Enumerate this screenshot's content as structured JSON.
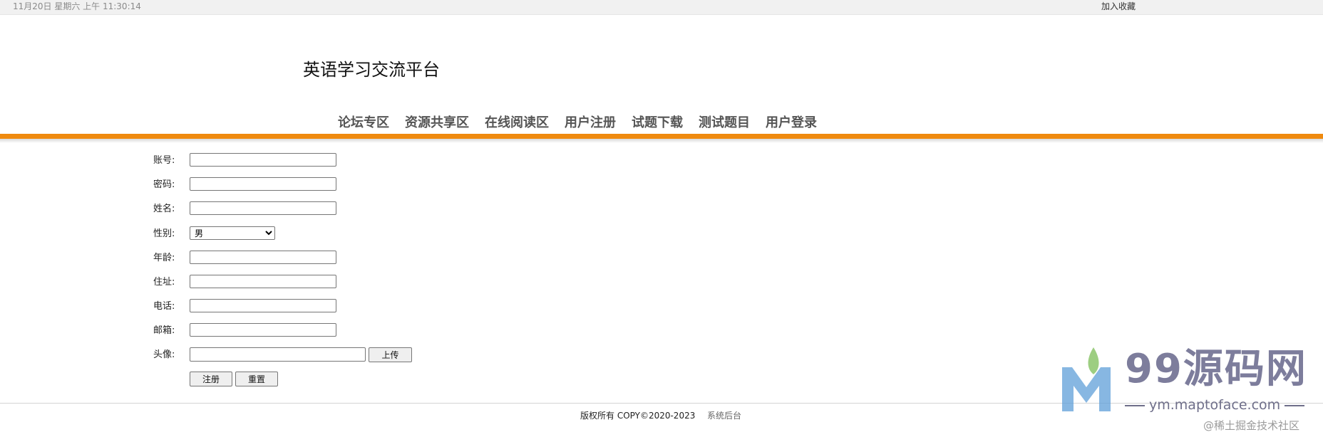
{
  "topbar": {
    "datetime": "11月20日 星期六 上午 11:30:14",
    "favorite_link": "加入收藏"
  },
  "header": {
    "title": "英语学习交流平台"
  },
  "nav": {
    "items": [
      "论坛专区",
      "资源共享区",
      "在线阅读区",
      "用户注册",
      "试题下载",
      "测试题目",
      "用户登录"
    ]
  },
  "form": {
    "account_label": "账号:",
    "account_value": "",
    "password_label": "密码:",
    "password_value": "",
    "name_label": "姓名:",
    "name_value": "",
    "gender_label": "性别:",
    "gender_selected": "男",
    "age_label": "年龄:",
    "age_value": "",
    "address_label": "住址:",
    "address_value": "",
    "phone_label": "电话:",
    "phone_value": "",
    "email_label": "邮箱:",
    "email_value": "",
    "avatar_label": "头像:",
    "avatar_value": "",
    "upload_button": "上传",
    "register_button": "注册",
    "reset_button": "重置"
  },
  "footer": {
    "copyright": "版权所有 COPY©2020-2023",
    "admin_link": "系统后台"
  },
  "watermark": {
    "brand": "99源码网",
    "url": "ym.maptoface.com",
    "community": "@稀土掘金技术社区"
  },
  "colors": {
    "nav_bar": "#ef8a0f",
    "logo_blue": "#5f9fd8",
    "logo_green": "#8cc66b"
  }
}
